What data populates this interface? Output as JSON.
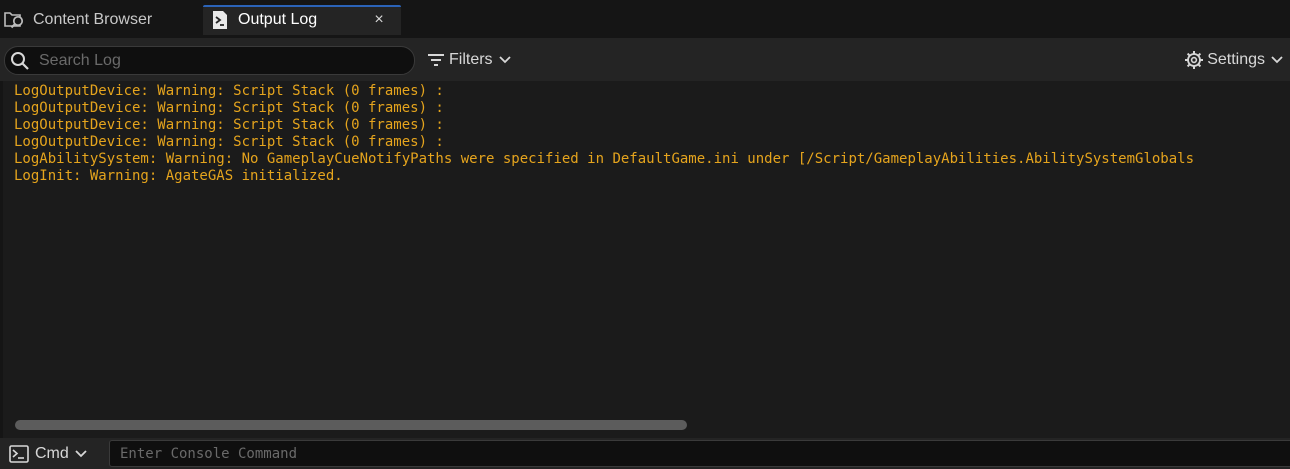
{
  "tabs": [
    {
      "label": "Content Browser",
      "icon": "folder-search-icon",
      "active": false
    },
    {
      "label": "Output Log",
      "icon": "terminal-doc-icon",
      "active": true,
      "close": "×"
    }
  ],
  "toolbar": {
    "search_placeholder": "Search Log",
    "search_value": "",
    "filters_label": "Filters",
    "settings_label": "Settings"
  },
  "log": {
    "lines": [
      "LogOutputDevice: Warning: Script Stack (0 frames) :",
      "LogOutputDevice: Warning: Script Stack (0 frames) :",
      "LogOutputDevice: Warning: Script Stack (0 frames) :",
      "LogOutputDevice: Warning: Script Stack (0 frames) :",
      "LogAbilitySystem: Warning: No GameplayCueNotifyPaths were specified in DefaultGame.ini under [/Script/GameplayAbilities.AbilitySystemGlobals",
      "LogInit: Warning: AgateGAS initialized."
    ],
    "warning_color": "#e5a41d"
  },
  "console": {
    "cmd_label": "Cmd",
    "input_placeholder": "Enter Console Command",
    "input_value": ""
  },
  "colors": {
    "accent": "#2b63b8",
    "panel": "#242424",
    "log_bg": "#1b1b1b"
  }
}
